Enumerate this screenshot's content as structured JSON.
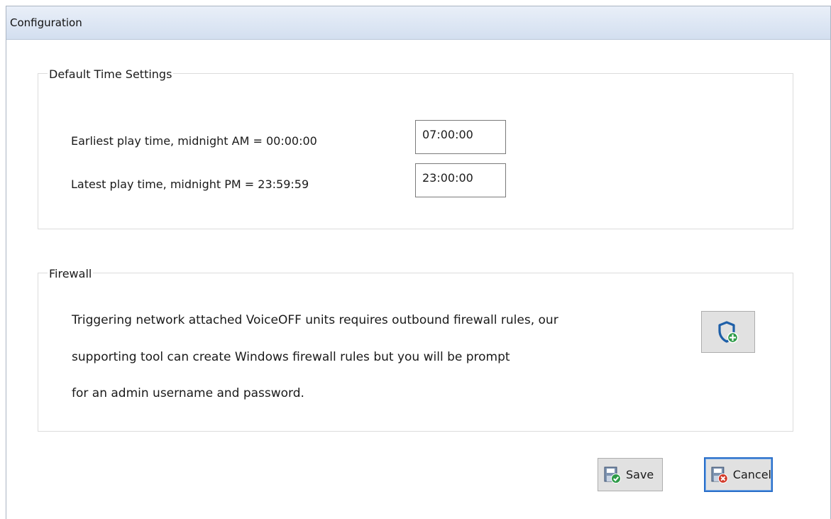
{
  "window": {
    "title": "Configuration"
  },
  "time_settings": {
    "group_title": "Default Time Settings",
    "earliest_label": "Earliest play time, midnight AM = 00:00:00",
    "earliest_value": "07:00:00",
    "latest_label": "Latest play time, midnight PM = 23:59:59",
    "latest_value": "23:00:00"
  },
  "firewall": {
    "group_title": "Firewall",
    "description_lines": [
      "Triggering network attached VoiceOFF units requires outbound firewall rules, our",
      "supporting tool can create Windows firewall rules but you will be prompt",
      "for an admin username and password."
    ],
    "add_rule_icon": "shield-plus-icon"
  },
  "buttons": {
    "save_label": "Save",
    "save_icon": "save-check-icon",
    "cancel_label": "Cancel",
    "cancel_icon": "save-cancel-icon"
  },
  "colors": {
    "title_bar": "#d3dff0",
    "shield_blue": "#1e5fa8",
    "plus_green": "#2e9b48",
    "cancel_red": "#d23a2a",
    "focus_border": "#2a6fc9"
  }
}
